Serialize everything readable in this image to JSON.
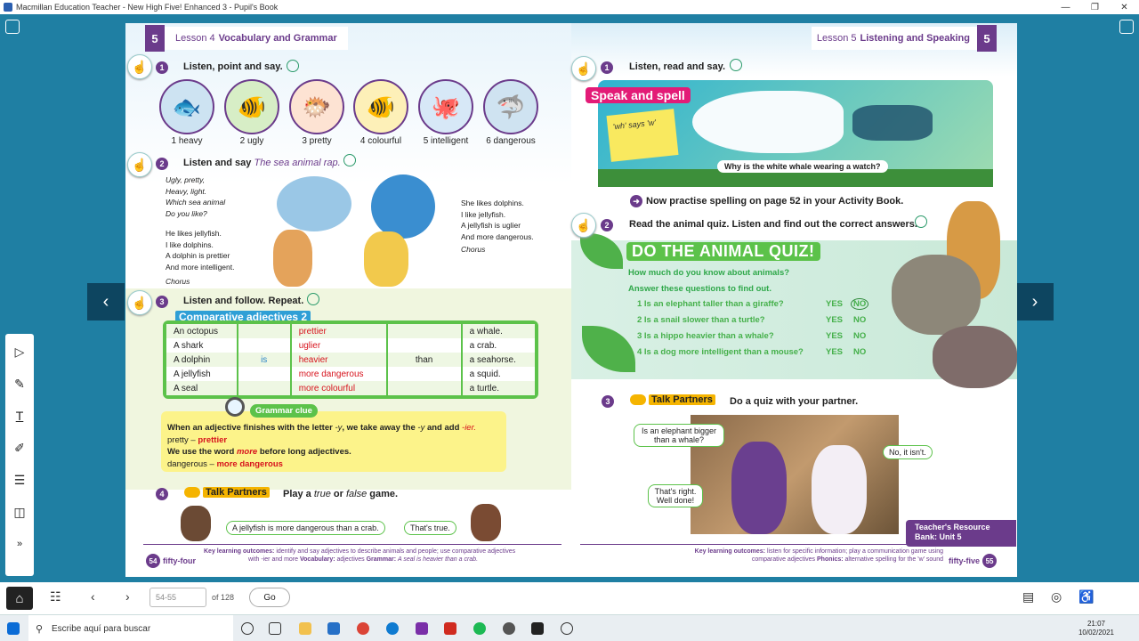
{
  "window": {
    "title": "Macmillan Education Teacher - New High Five! Enhanced 3 - Pupil's Book",
    "controls": [
      "—",
      "❐",
      "✕"
    ]
  },
  "nav": {
    "prev": "‹",
    "next": "›"
  },
  "left_tools": [
    "pointer-icon",
    "eraser-icon",
    "text-icon",
    "pen-icon",
    "notes-icon",
    "layout-icon",
    "expand-icon"
  ],
  "left_tool_glyphs": [
    "▷",
    "✎",
    "T",
    "✐",
    "☰",
    "◫",
    "»"
  ],
  "left_page": {
    "lesson_num": "5",
    "lesson_label": "Lesson 4",
    "lesson_title": "Vocabulary and Grammar",
    "ex1": {
      "num": "1",
      "text": "Listen, point and say."
    },
    "animals": [
      {
        "label": "1 heavy",
        "emoji": "🐟"
      },
      {
        "label": "2 ugly",
        "emoji": "🐠"
      },
      {
        "label": "3 pretty",
        "emoji": "🐡"
      },
      {
        "label": "4 colourful",
        "emoji": "🐠"
      },
      {
        "label": "5 intelligent",
        "emoji": "🐙"
      },
      {
        "label": "6 dangerous",
        "emoji": "🦈"
      }
    ],
    "ex2": {
      "num": "2",
      "text": "Listen and say",
      "italic": "The sea animal rap."
    },
    "poem1": [
      "Ugly, pretty,",
      "Heavy, light.",
      "Which sea animal",
      "Do you like?"
    ],
    "poem2": [
      "He likes jellyfish.",
      "I like dolphins.",
      "A dolphin is prettier",
      "And more intelligent."
    ],
    "poem2_chorus": "Chorus",
    "poem3": [
      "She likes dolphins.",
      "I like jellyfish.",
      "A jellyfish is uglier",
      "And more dangerous."
    ],
    "poem3_chorus": "Chorus",
    "ex3": {
      "num": "3",
      "text": "Listen and follow. Repeat."
    },
    "comp_title": "Comparative adjectives 2",
    "table": {
      "subjects": [
        "An octopus",
        "A shark",
        "A dolphin",
        "A jellyfish",
        "A seal"
      ],
      "verb": "is",
      "adjectives": [
        "prettier",
        "uglier",
        "heavier",
        "more dangerous",
        "more colourful"
      ],
      "than": "than",
      "objects": [
        "a whale.",
        "a crab.",
        "a seahorse.",
        "a squid.",
        "a turtle."
      ]
    },
    "grammar_clue": {
      "label": "Grammar clue",
      "line1a": "When an adjective finishes with the letter ",
      "line1b": "-y",
      "line1c": ", we take away the ",
      "line1d": "-y",
      "line1e": " and add ",
      "line1f": "-ier.",
      "ex1a": "pretty – ",
      "ex1b": "prettier",
      "line2a": "We use the word ",
      "line2b": "more",
      "line2c": " before long adjectives.",
      "ex2a": "dangerous – ",
      "ex2b": "more dangerous"
    },
    "ex4": {
      "num": "4",
      "tp": "Talk Partners",
      "text_a": "Play a ",
      "text_b": "true",
      "text_c": " or ",
      "text_d": "false",
      "text_e": " game."
    },
    "bubble1": "A jellyfish is more dangerous than a crab.",
    "bubble2": "That's true.",
    "footer_key": "Key learning outcomes:",
    "footer_line1": "identify and say adjectives to describe animals and people; use comparative adjectives",
    "footer_line2a": "with ",
    "footer_line2b": "-ier and more",
    "footer_vocab": "Vocabulary:",
    "footer_vocab_val": "adjectives",
    "footer_gram": "Grammar:",
    "footer_gram_val": "A seal is heavier than a crab.",
    "page_num": "54",
    "page_word": "fifty-four"
  },
  "right_page": {
    "lesson_num": "5",
    "lesson_label": "Lesson 5",
    "lesson_title": "Listening and Speaking",
    "ex1": {
      "num": "1",
      "text": "Listen, read and say."
    },
    "speak_title": "Speak and spell",
    "sticky": "'wh' says 'w'",
    "whale_q": "Why is the white whale wearing a watch?",
    "practise": "Now practise spelling on page 52 in your Activity Book.",
    "ex2": {
      "num": "2",
      "text": "Read the animal quiz. Listen and find out the correct answers."
    },
    "quiz_title": "DO THE ANIMAL QUIZ!",
    "quiz_sub1": "How much do you know about animals?",
    "quiz_sub2": "Answer these questions to find out.",
    "quiz": [
      {
        "q": "1 Is an elephant taller than a giraffe?",
        "yes": "YES",
        "no": "NO",
        "no_circled": true
      },
      {
        "q": "2 Is a snail slower than a turtle?",
        "yes": "YES",
        "no": "NO",
        "no_circled": false
      },
      {
        "q": "3 Is a hippo heavier than a whale?",
        "yes": "YES",
        "no": "NO",
        "no_circled": false
      },
      {
        "q": "4 Is a dog more intelligent than a mouse?",
        "yes": "YES",
        "no": "NO",
        "no_circled": false
      }
    ],
    "ex3": {
      "num": "3",
      "tp": "Talk Partners",
      "text": "Do a quiz with your partner."
    },
    "bubble_q": "Is an elephant bigger than a whale?",
    "bubble_no": "No, it isn't.",
    "bubble_right": "That's right. Well done!",
    "teacher_res": "Teacher's Resource Bank: Unit 5",
    "footer_key": "Key learning outcomes:",
    "footer_line1": "listen for specific information; play a communication game using",
    "footer_line2a": "comparative adjectives",
    "footer_phon": "Phonics:",
    "footer_phon_val": "alternative spelling for the 'w' sound",
    "page_num": "55",
    "page_word": "fifty-five"
  },
  "bottom": {
    "page_value": "54-55",
    "of_text": "of 128",
    "go": "Go"
  },
  "taskbar": {
    "search_placeholder": "Escribe aquí para buscar",
    "time": "21:07",
    "date": "10/02/2021"
  },
  "colors": {
    "accent": "#6b3b8b",
    "green": "#5cc24a",
    "red": "#d7131d",
    "app_bg": "#1f7fa3"
  }
}
